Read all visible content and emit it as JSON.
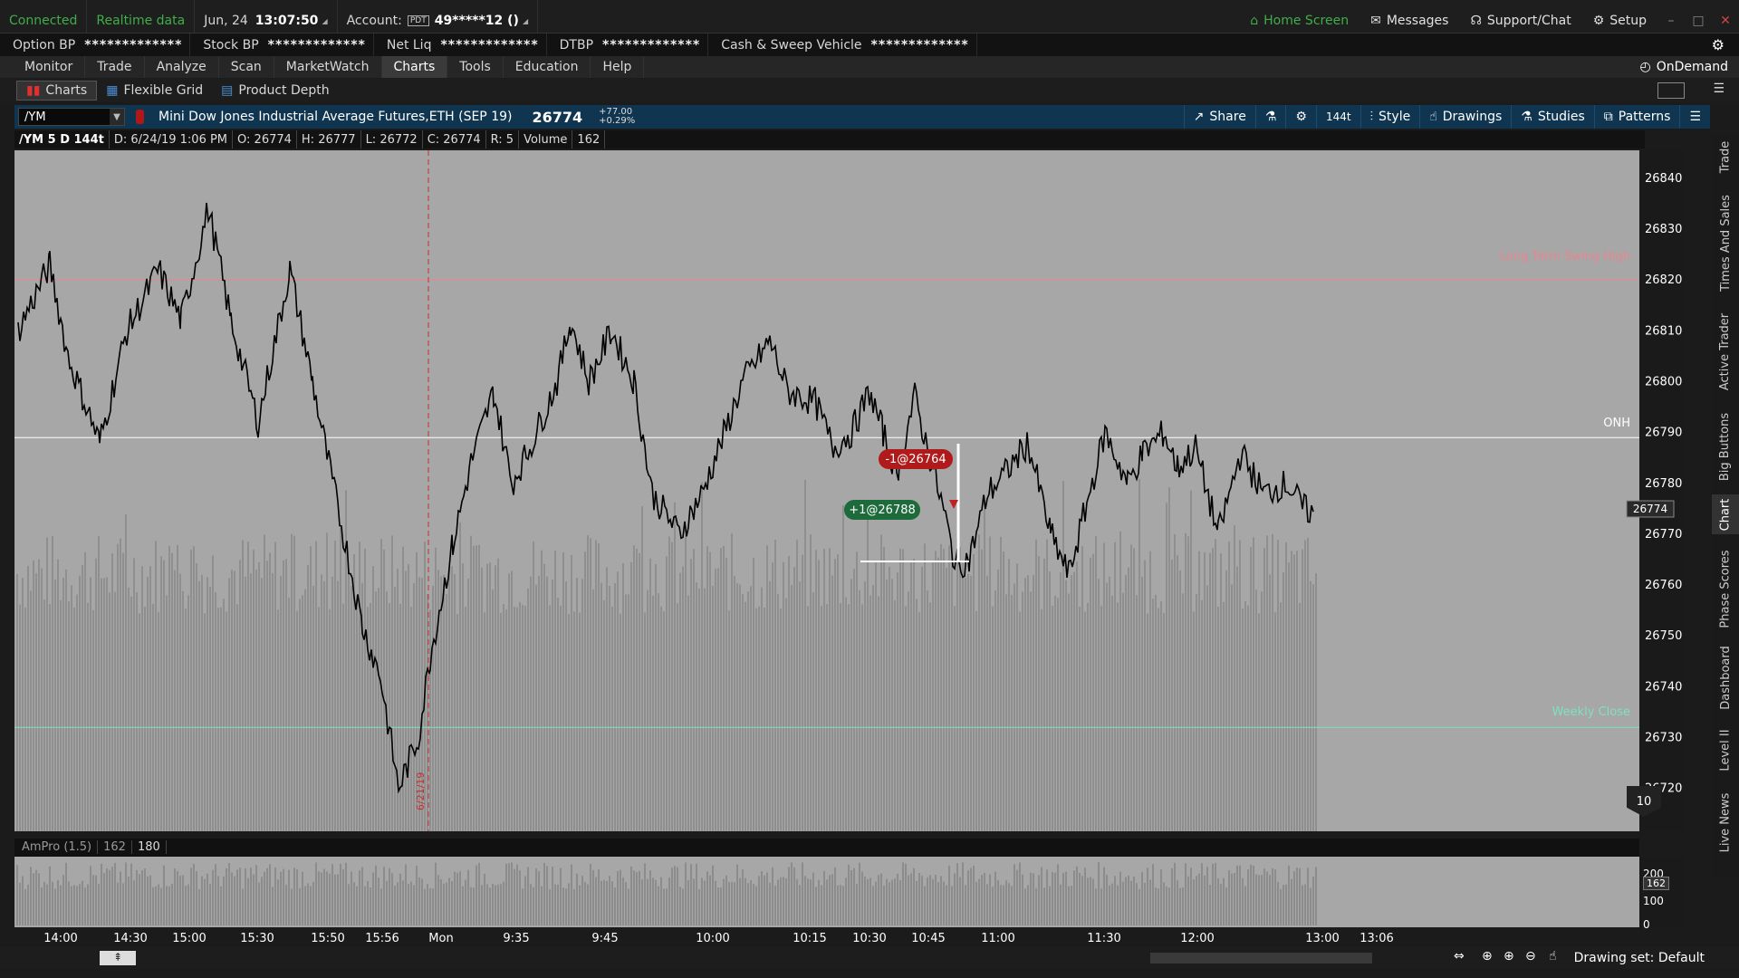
{
  "status": {
    "connection": "Connected",
    "data_mode": "Realtime data",
    "date": "Jun, 24",
    "time": "13:07:50",
    "account_label": "Account:",
    "account_type": "PDT",
    "account_number": "49*****12 ()"
  },
  "top_links": {
    "home": "Home Screen",
    "messages": "Messages",
    "support": "Support/Chat",
    "setup": "Setup"
  },
  "bp_bar": [
    {
      "label": "Option BP",
      "value": "*************"
    },
    {
      "label": "Stock BP",
      "value": "*************"
    },
    {
      "label": "Net Liq",
      "value": "*************"
    },
    {
      "label": "DTBP",
      "value": "*************"
    },
    {
      "label": "Cash & Sweep Vehicle",
      "value": "*************"
    }
  ],
  "menu": {
    "tabs": [
      "Monitor",
      "Trade",
      "Analyze",
      "Scan",
      "MarketWatch",
      "Charts",
      "Tools",
      "Education",
      "Help"
    ],
    "active": "Charts",
    "ondemand": "OnDemand"
  },
  "subtabs": {
    "charts": "Charts",
    "flexible_grid": "Flexible Grid",
    "product_depth": "Product Depth"
  },
  "chart_header": {
    "symbol": "/YM",
    "instrument": "Mini Dow Jones Industrial Average Futures,ETH (SEP 19)",
    "last": "26774",
    "change": "+77.00",
    "change_pct": "+0.29%",
    "share": "Share",
    "tick_agg": "144t",
    "style": "Style",
    "drawings": "Drawings",
    "studies": "Studies",
    "patterns": "Patterns"
  },
  "info_bar": {
    "symbol": "/YM 5 D 144t",
    "date": "D: 6/24/19 1:06 PM",
    "open": "O: 26774",
    "high": "H: 26777",
    "low": "L: 26772",
    "close": "C: 26774",
    "range": "R: 5",
    "volume_label": "Volume",
    "volume_value": "162"
  },
  "chart_data": {
    "type": "line",
    "y_ticks": [
      26840,
      26830,
      26820,
      26810,
      26800,
      26790,
      26780,
      26770,
      26760,
      26750,
      26740,
      26730,
      26720
    ],
    "ylim": [
      26713,
      26843
    ],
    "x_ticks": [
      "14:00",
      "14:30",
      "15:00",
      "15:30",
      "15:50",
      "15:56",
      "Mon",
      "9:35",
      "9:45",
      "10:00",
      "10:15",
      "10:30",
      "10:45",
      "11:00",
      "11:30",
      "12:00",
      "13:00",
      "13:06"
    ],
    "levels": [
      {
        "label": "Long Term Swing High",
        "value": 26820,
        "color": "#e8868e"
      },
      {
        "label": "ONH",
        "value": 26789,
        "color": "#ffffff"
      },
      {
        "label": "Weekly Close",
        "value": 26732,
        "color": "#7fe0c3"
      }
    ],
    "session_marker": "6/21/19",
    "last_price_label": "26774",
    "orders": [
      {
        "label": "-1@26764",
        "color": "#b01a1a"
      },
      {
        "label": "+1@26788",
        "color": "#1d6a3a"
      }
    ],
    "badge": "10",
    "volume_study": {
      "label": "AmPro (1.5)",
      "value1": "162",
      "value2": "180",
      "scale": [
        "200",
        "100",
        "0"
      ],
      "last_label": "162"
    }
  },
  "right_sidebar": [
    "Trade",
    "Times And Sales",
    "Active Trader",
    "Big Buttons",
    "Chart",
    "Phase Scores",
    "Dashboard",
    "Level II",
    "Live News"
  ],
  "footer": {
    "drawing_set": "Drawing set: Default"
  }
}
